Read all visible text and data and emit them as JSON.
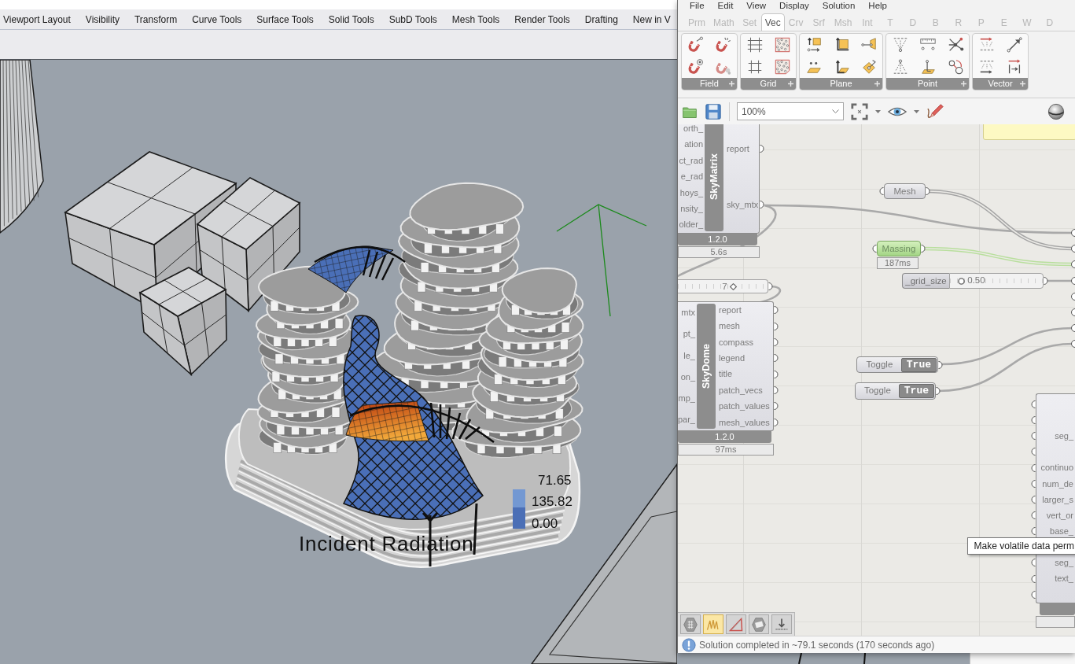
{
  "rhino": {
    "tabs": [
      "Viewport Layout",
      "Visibility",
      "Transform",
      "Curve Tools",
      "Surface Tools",
      "Solid Tools",
      "SubD Tools",
      "Mesh Tools",
      "Render Tools",
      "Drafting",
      "New in V"
    ]
  },
  "viewport": {
    "legend": {
      "labels": [
        "71.65",
        "135.82",
        "0.00"
      ],
      "swatches": [
        {
          "color": "#7398d2"
        },
        {
          "color": "#4b6fb6"
        }
      ],
      "title": "Incident Radiation"
    }
  },
  "grasshopper": {
    "menu": [
      "File",
      "Edit",
      "View",
      "Display",
      "Solution",
      "Help"
    ],
    "tabs": [
      {
        "label": "Prm",
        "selected": false
      },
      {
        "label": "Math",
        "selected": false
      },
      {
        "label": "Set",
        "selected": false
      },
      {
        "label": "Vec",
        "selected": true
      },
      {
        "label": "Crv",
        "selected": false
      },
      {
        "label": "Srf",
        "selected": false
      },
      {
        "label": "Msh",
        "selected": false
      },
      {
        "label": "Int",
        "selected": false
      },
      {
        "label": "T",
        "selected": false
      },
      {
        "label": "D",
        "selected": false
      },
      {
        "label": "B",
        "selected": false
      },
      {
        "label": "R",
        "selected": false
      },
      {
        "label": "P",
        "selected": false
      },
      {
        "label": "E",
        "selected": false
      },
      {
        "label": "W",
        "selected": false
      },
      {
        "label": "D",
        "selected": false
      }
    ],
    "ribbon_panels": [
      "Field",
      "Grid",
      "Plane",
      "Point",
      "Vector"
    ],
    "zoom": "100%",
    "components": [
      {
        "kind": "component",
        "name": "SkyMatrix",
        "inputs": [
          "orth_",
          "ation",
          "ct_rad",
          "e_rad",
          "hoys_",
          "nsity_",
          "older_"
        ],
        "outputs": [
          "report",
          "sky_mtx"
        ],
        "version": "1.2.0",
        "time": "5.6s"
      },
      {
        "kind": "param",
        "name": "Mesh",
        "selected": false
      },
      {
        "kind": "param",
        "name": "Massing",
        "selected": true,
        "time": "187ms"
      },
      {
        "kind": "slider",
        "name": "_grid_size",
        "value": "0.50",
        "level": 0.12,
        "integer": false
      },
      {
        "kind": "slider",
        "value": "7",
        "level": 0.62,
        "integer": true
      },
      {
        "kind": "component",
        "name": "SkyDome",
        "inputs": [
          "mtx",
          "pt_",
          "le_",
          "on_",
          "mp_",
          "par_"
        ],
        "outputs": [
          "report",
          "mesh",
          "compass",
          "legend",
          "title",
          "patch_vecs",
          "patch_values",
          "mesh_values"
        ],
        "version": "1.2.0",
        "time": "97ms"
      },
      {
        "kind": "toggle",
        "name": "Toggle",
        "value": "True"
      },
      {
        "kind": "toggle",
        "name": "Toggle",
        "value": "True"
      },
      {
        "kind": "component",
        "inputs": [
          "seg_",
          "continuo",
          "num_de",
          "larger_s",
          "vert_or",
          "base_",
          "seg_",
          "text_"
        ]
      }
    ],
    "tooltip": "Make volatile data perm",
    "widgets": [
      {
        "selected": false
      },
      {
        "selected": true
      },
      {
        "selected": false
      },
      {
        "selected": false
      },
      {
        "selected": false
      }
    ],
    "status": "Solution completed in ~79.1 seconds (170 seconds ago)"
  }
}
